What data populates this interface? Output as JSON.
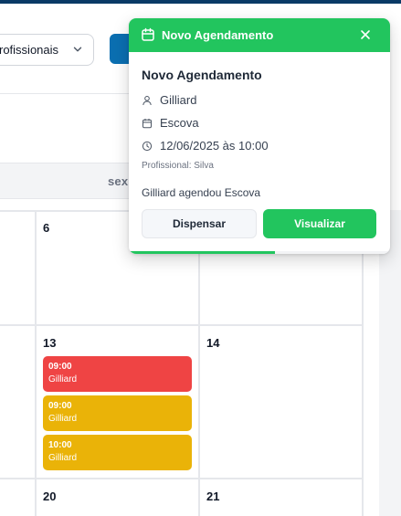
{
  "filter": {
    "value": "rofissionais"
  },
  "week_header": {
    "day": "sex"
  },
  "calendar": {
    "days": [
      {
        "num": "6"
      },
      {
        "num": "13"
      },
      {
        "num": "14"
      },
      {
        "num": "20"
      },
      {
        "num": "21"
      }
    ],
    "events": [
      {
        "time": "09:00",
        "name": "Gilliard",
        "color": "#ef4444"
      },
      {
        "time": "09:00",
        "name": "Gilliard",
        "color": "#eab308"
      },
      {
        "time": "10:00",
        "name": "Gilliard",
        "color": "#eab308"
      }
    ]
  },
  "toast": {
    "header_title": "Novo Agendamento",
    "title": "Novo Agendamento",
    "client": "Gilliard",
    "service": "Escova",
    "datetime": "12/06/2025 às 10:00",
    "professional": "Profissional: Silva",
    "message": "Gilliard agendou Escova",
    "dismiss_label": "Dispensar",
    "view_label": "Visualizar",
    "progress": 0.56,
    "accent": "#22c55e"
  },
  "icons": {
    "header": "calendar-icon",
    "close": "close-icon",
    "client": "user-icon",
    "service": "calendar-icon",
    "datetime": "clock-icon",
    "dropdown": "chevron-down-icon"
  }
}
